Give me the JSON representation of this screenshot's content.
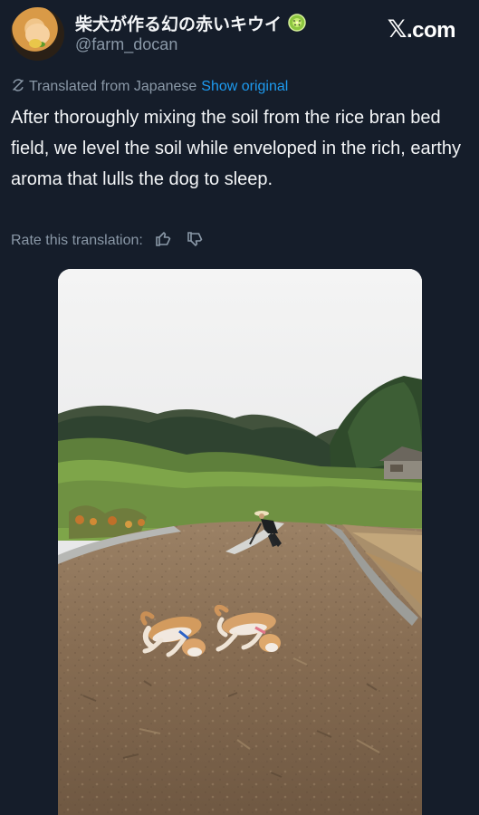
{
  "header": {
    "display_name": "柴犬が作る幻の赤いキウイ",
    "handle": "@farm_docan",
    "brand": ".com",
    "avatar": "shiba-dog-avatar"
  },
  "translation": {
    "translated_from": "Translated from Japanese",
    "show_original": "Show original",
    "icon": "translate-icon"
  },
  "post": {
    "text": "After thoroughly mixing the soil from the rice bran bed field, we level the soil while enveloped in the rich, earthy aroma that lulls the dog to sleep."
  },
  "rating": {
    "label": "Rate this translation:",
    "thumbs_up_icon": "thumbs-up-icon",
    "thumbs_down_icon": "thumbs-down-icon"
  },
  "media": {
    "type": "photo",
    "description_icon": "farm-field-photo"
  },
  "colors": {
    "background": "#151d2a",
    "text": "#f3f5f7",
    "muted": "#8a98a7",
    "link": "#1d9bf0"
  }
}
